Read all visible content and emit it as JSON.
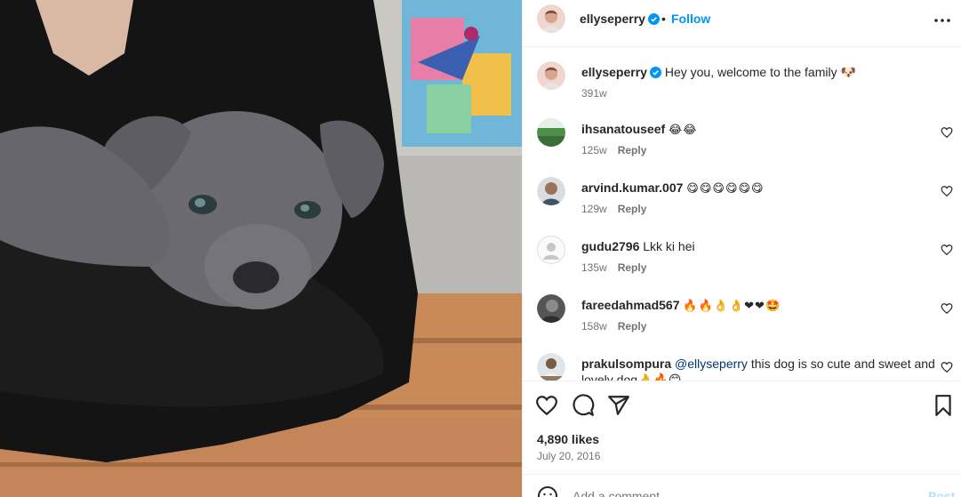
{
  "post": {
    "username": "ellyseperry",
    "separator": "•",
    "follow_label": "Follow",
    "caption": "Hey you, welcome to the family 🐶",
    "caption_time": "391w"
  },
  "comments": [
    {
      "username": "ihsanatouseef",
      "text": "😂😂",
      "time": "125w",
      "reply": "Reply"
    },
    {
      "username": "arvind.kumar.007",
      "text": "😋😋😋😋😋😋",
      "time": "129w",
      "reply": "Reply"
    },
    {
      "username": "gudu2796",
      "text": "Lkk ki hei",
      "time": "135w",
      "reply": "Reply"
    },
    {
      "username": "fareedahmad567",
      "text": "🔥🔥👌👌❤❤🤩",
      "time": "158w",
      "reply": "Reply"
    },
    {
      "username": "prakulsompura",
      "mention": "@ellyseperry",
      "text": "this dog is so cute and sweet and lovely dog👌🔥😊",
      "time": "",
      "reply": ""
    }
  ],
  "stats": {
    "likes": "4,890 likes",
    "date": "July 20, 2016"
  },
  "add_comment": {
    "placeholder": "Add a comment...",
    "post_label": "Post"
  },
  "icons": [
    "verified-icon",
    "more-icon",
    "heart-icon",
    "comment-icon",
    "share-icon",
    "bookmark-icon",
    "emoji-icon"
  ],
  "colors": {
    "accent": "#0095f6",
    "text": "#262626",
    "secondary": "#737373",
    "mention": "#00376b"
  }
}
